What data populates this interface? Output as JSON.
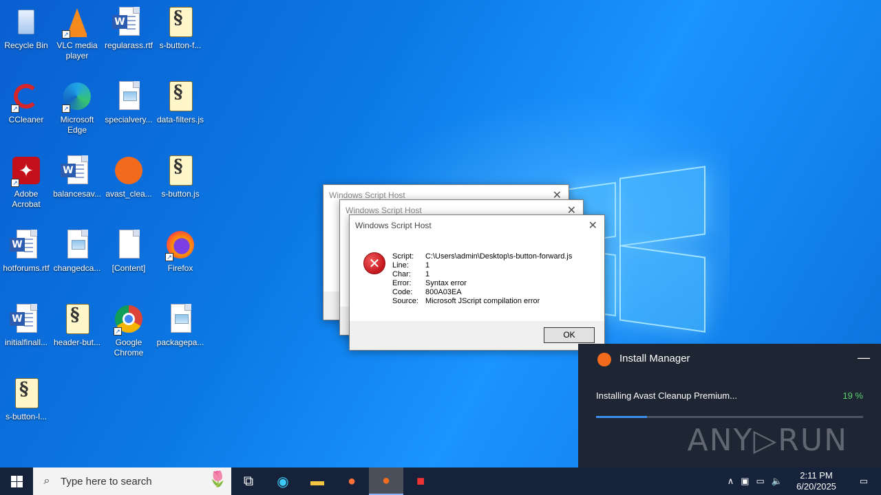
{
  "desktop_icons": [
    {
      "label": "Recycle Bin",
      "kind": "recycle-bin"
    },
    {
      "label": "VLC media player",
      "kind": "vlc"
    },
    {
      "label": "regularass.rtf",
      "kind": "word-doc"
    },
    {
      "label": "s-button-f...",
      "kind": "script"
    },
    {
      "label": "CCleaner",
      "kind": "ccleaner"
    },
    {
      "label": "Microsoft Edge",
      "kind": "edge"
    },
    {
      "label": "specialvery...",
      "kind": "image-doc"
    },
    {
      "label": "data-filters.js",
      "kind": "script"
    },
    {
      "label": "Adobe Acrobat",
      "kind": "acrobat"
    },
    {
      "label": "balancesav...",
      "kind": "word-doc"
    },
    {
      "label": "avast_clea...",
      "kind": "avast"
    },
    {
      "label": "s-button.js",
      "kind": "script"
    },
    {
      "label": "hotforums.rtf",
      "kind": "word-doc"
    },
    {
      "label": "changedca...",
      "kind": "image-doc"
    },
    {
      "label": "[Content]",
      "kind": "blank-doc"
    },
    {
      "label": "Firefox",
      "kind": "firefox"
    },
    {
      "label": "initialfinall...",
      "kind": "word-doc"
    },
    {
      "label": "header-but...",
      "kind": "script"
    },
    {
      "label": "Google Chrome",
      "kind": "chrome"
    },
    {
      "label": "packagepa...",
      "kind": "image-doc"
    },
    {
      "label": "s-button-l...",
      "kind": "script"
    }
  ],
  "dialogs": {
    "back1_title": "Windows Script Host",
    "back2_title": "Windows Script Host",
    "front": {
      "title": "Windows Script Host",
      "close_glyph": "✕",
      "error_glyph": "✕",
      "rows": [
        {
          "key": "Script:",
          "value": "C:\\Users\\admin\\Desktop\\s-button-forward.js"
        },
        {
          "key": "Line:",
          "value": "1"
        },
        {
          "key": "Char:",
          "value": "1"
        },
        {
          "key": "Error:",
          "value": "Syntax error"
        },
        {
          "key": "Code:",
          "value": "800A03EA"
        },
        {
          "key": "Source:",
          "value": "Microsoft JScript compilation error"
        }
      ],
      "ok_label": "OK"
    }
  },
  "install_manager": {
    "title": "Install Manager",
    "status": "Installing Avast Cleanup Premium...",
    "percent_label": "19 %",
    "progress": 0.19,
    "minimize_glyph": "—",
    "watermark": "ANY▷RUN"
  },
  "taskbar": {
    "search_placeholder": "Type here to search",
    "time": "2:11 PM",
    "date": "6/20/2025"
  },
  "colors": {
    "accent": "#3e8ff0",
    "progress_text": "#5dd36b",
    "taskbar": "#15223a"
  }
}
